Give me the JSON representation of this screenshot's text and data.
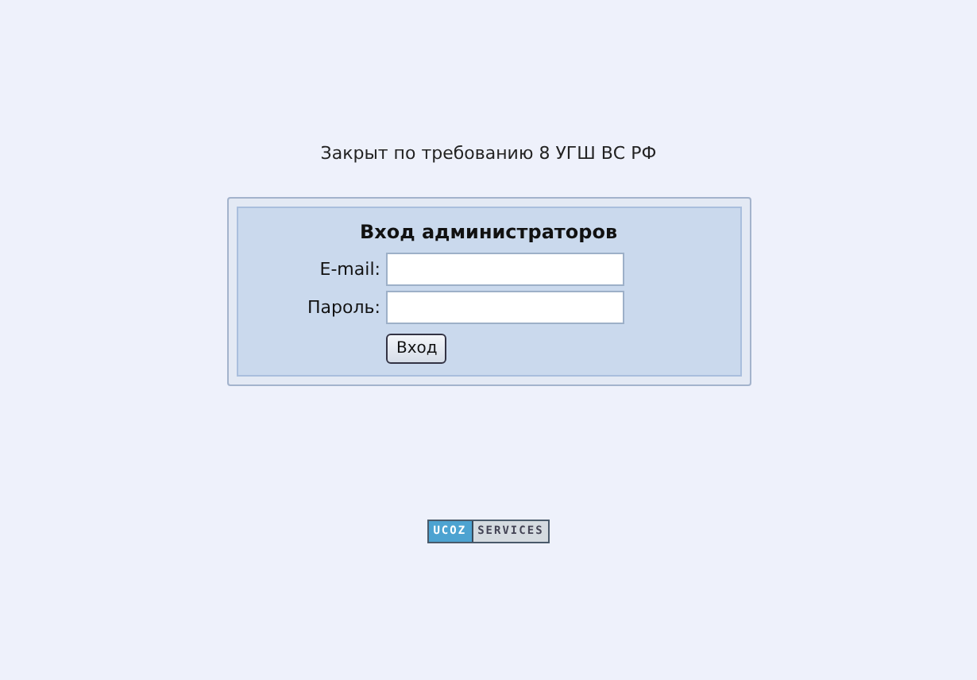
{
  "message": "Закрыт по требованию 8 УГШ ВС РФ",
  "login_form": {
    "title": "Вход администраторов",
    "fields": [
      {
        "label": "E-mail:"
      },
      {
        "label": "Пароль:"
      }
    ],
    "submit": "Вход"
  },
  "badge": {
    "left": "UCOZ",
    "right": "SERVICES"
  }
}
